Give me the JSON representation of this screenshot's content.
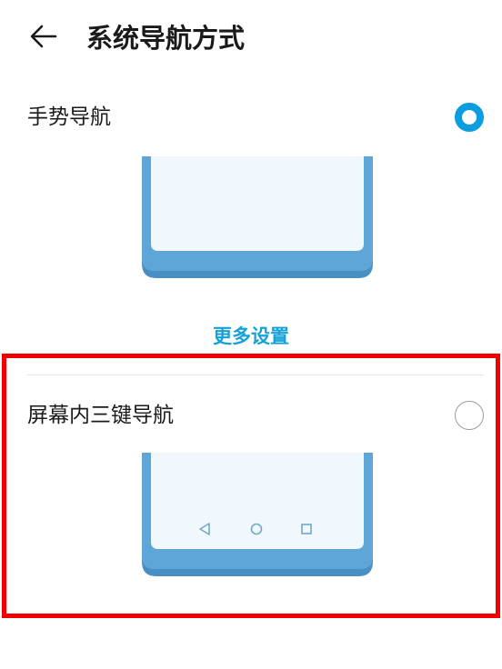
{
  "header": {
    "back_icon": "arrow-left-icon",
    "title": "系统导航方式"
  },
  "gesture_nav": {
    "label": "手势导航",
    "selected": true
  },
  "more_settings": {
    "label": "更多设置"
  },
  "three_key_nav": {
    "label": "屏幕内三键导航",
    "selected": false,
    "nav_icons": [
      "triangle-back-icon",
      "circle-home-icon",
      "square-recents-icon"
    ]
  },
  "colors": {
    "accent": "#0a9de0",
    "link": "#16a2d8",
    "phone_body": "#5ea6d8",
    "phone_shadow": "#4a8fc4",
    "phone_screen": "#f1f8fd",
    "highlight": "#f20000"
  }
}
